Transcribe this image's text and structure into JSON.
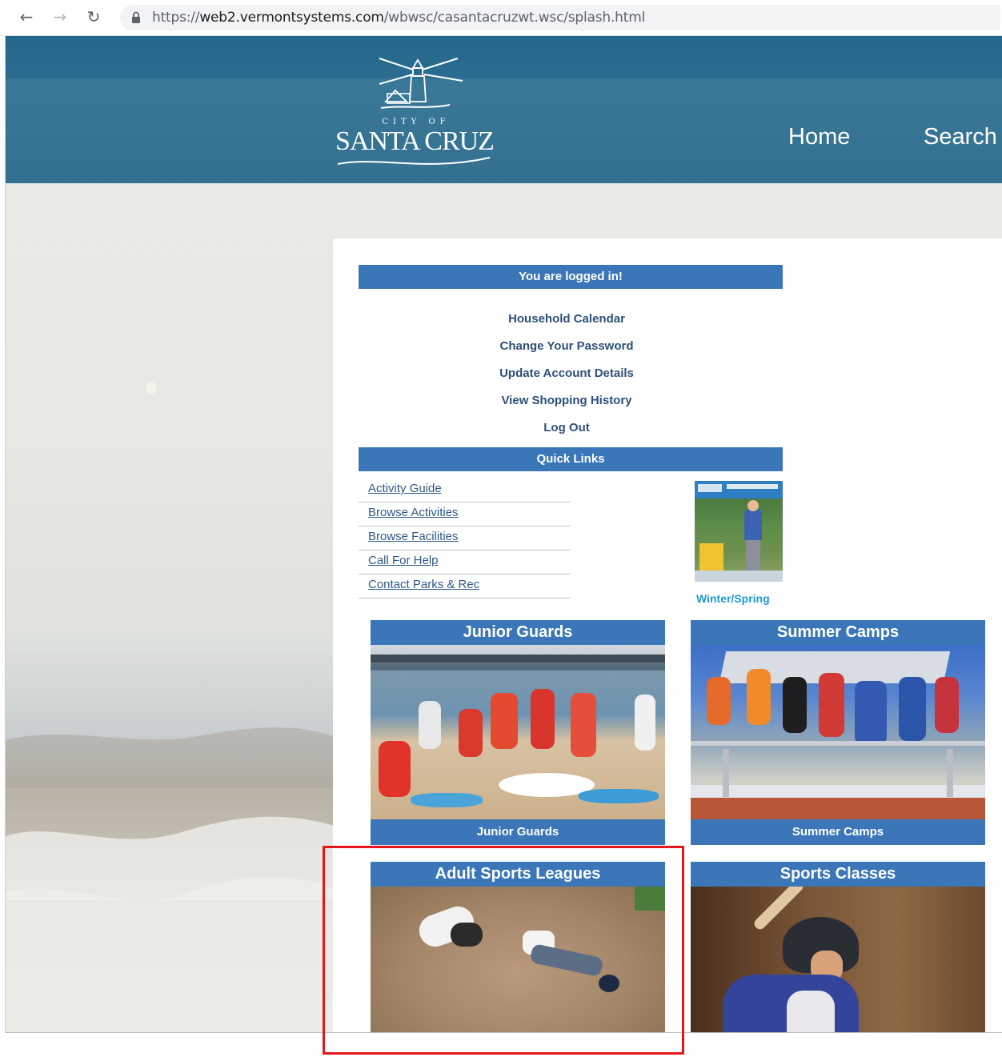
{
  "browser": {
    "url_prefix": "https://",
    "url_host": "web2.vermontsystems.com",
    "url_path": "/wbwsc/casantacruzwt.wsc/splash.html",
    "icons": [
      "back-arrow-icon",
      "forward-arrow-icon",
      "reload-icon",
      "lock-icon"
    ]
  },
  "header": {
    "logo_text_small": "CITY OF",
    "logo_text_big": "SANTA CRUZ",
    "nav": [
      "Home",
      "Search"
    ]
  },
  "account": {
    "status": "You are logged in!",
    "links": [
      "Household Calendar",
      "Change Your Password",
      "Update Account Details",
      "View Shopping History",
      "Log Out"
    ]
  },
  "quick_links": {
    "title": "Quick Links",
    "items": [
      "Activity Guide",
      "Browse Activities",
      "Browse Facilities",
      "Call For Help",
      "Contact Parks & Rec"
    ],
    "guide_caption": "Winter/Spring"
  },
  "tiles": [
    {
      "title": "Junior Guards",
      "footer": "Junior Guards"
    },
    {
      "title": "Summer Camps",
      "footer": "Summer Camps"
    },
    {
      "title": "Adult Sports Leagues",
      "footer": ""
    },
    {
      "title": "Sports Classes",
      "footer": ""
    }
  ],
  "colors": {
    "header_blue": "#2b6d90",
    "bar_blue": "#3b76b8",
    "link_dark": "#2e4f78",
    "highlight_red": "#e4161b"
  }
}
